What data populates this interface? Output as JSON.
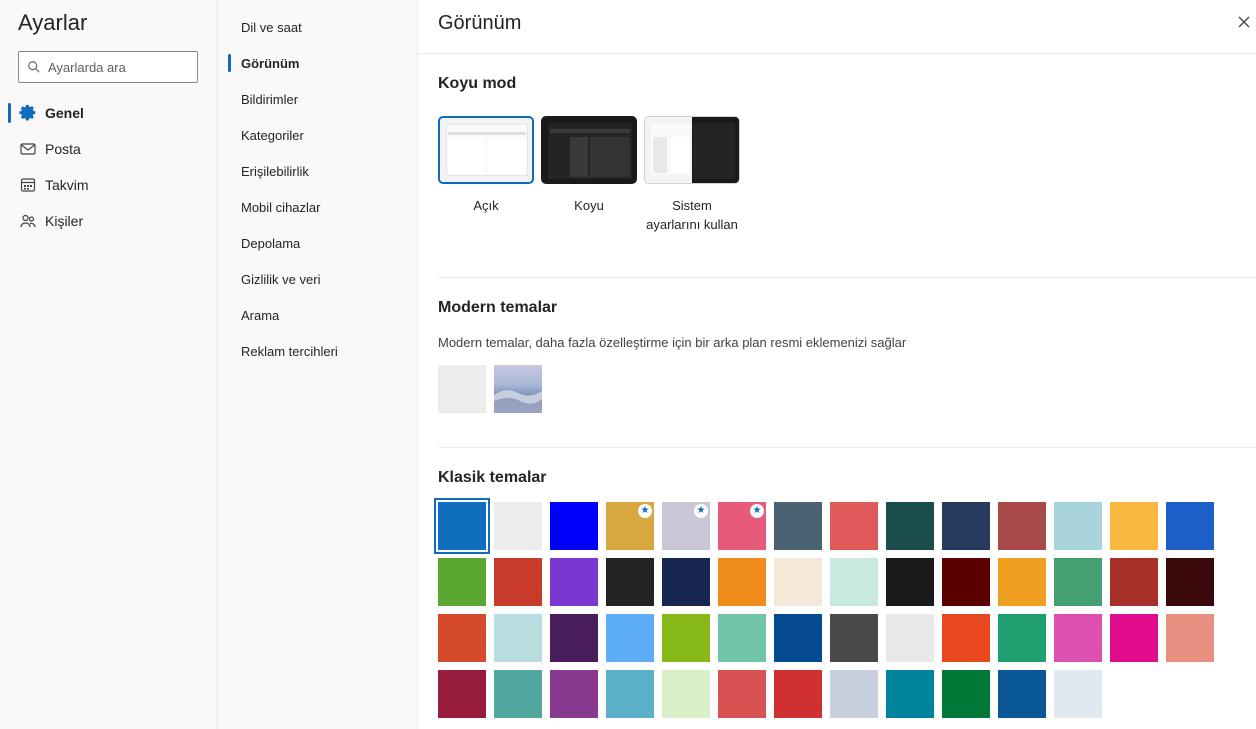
{
  "nav": {
    "title": "Ayarlar",
    "search_placeholder": "Ayarlarda ara",
    "items": [
      {
        "label": "Genel",
        "icon": "gear-icon",
        "active": true
      },
      {
        "label": "Posta",
        "icon": "mail-icon",
        "active": false
      },
      {
        "label": "Takvim",
        "icon": "calendar-icon",
        "active": false
      },
      {
        "label": "Kişiler",
        "icon": "people-icon",
        "active": false
      }
    ]
  },
  "subnav": {
    "items": [
      {
        "label": "Dil ve saat",
        "active": false
      },
      {
        "label": "Görünüm",
        "active": true
      },
      {
        "label": "Bildirimler",
        "active": false
      },
      {
        "label": "Kategoriler",
        "active": false
      },
      {
        "label": "Erişilebilirlik",
        "active": false
      },
      {
        "label": "Mobil cihazlar",
        "active": false
      },
      {
        "label": "Depolama",
        "active": false
      },
      {
        "label": "Gizlilik ve veri",
        "active": false
      },
      {
        "label": "Arama",
        "active": false
      },
      {
        "label": "Reklam tercihleri",
        "active": false
      }
    ]
  },
  "main": {
    "title": "Görünüm",
    "dark_mode": {
      "title": "Koyu mod",
      "options": [
        {
          "label": "Açık",
          "selected": true
        },
        {
          "label": "Koyu",
          "selected": false
        },
        {
          "label": "Sistem ayarlarını kullan",
          "selected": false
        }
      ]
    },
    "modern": {
      "title": "Modern temalar",
      "description": "Modern temalar, daha fazla özelleştirme için bir arka plan resmi eklemenizi sağlar"
    },
    "classic": {
      "title": "Klasik temalar",
      "selected_index": 0,
      "swatches": [
        "#106ebe",
        "#ececec",
        "#0000ff",
        "#d8a840",
        "#c9c7d8",
        "#e85a7a",
        "#4a6272",
        "#e05a5a",
        "#1b4d4d",
        "#263a5e",
        "#a84848",
        "#a8d4dc",
        "#f8b840",
        "#1c5fc8",
        "#5aa832",
        "#c83a2a",
        "#7a38d0",
        "#242424",
        "#172650",
        "#f08c1c",
        "#f4e8d8",
        "#c8e8e0",
        "#1a1a1a",
        "#5a0000",
        "#f0a020",
        "#44a070",
        "#a83028",
        "#3a0808",
        "#d44a2a",
        "#b8dce0",
        "#4a1e5a",
        "#5cacf8",
        "#86b818",
        "#70c4a8",
        "#044a90",
        "#4a4a4a",
        "#e8e8e8",
        "#e84820",
        "#20a070",
        "#de50b0",
        "#e00c8c",
        "#e89080",
        "#981c3c",
        "#50a8a0",
        "#883a90",
        "#5ab0c8",
        "#d8f0c8",
        "#d85050",
        "#d03030",
        "#c8d0e0",
        "#00849c",
        "#007838",
        "#0a5898",
        "#e0e8f0"
      ]
    }
  }
}
